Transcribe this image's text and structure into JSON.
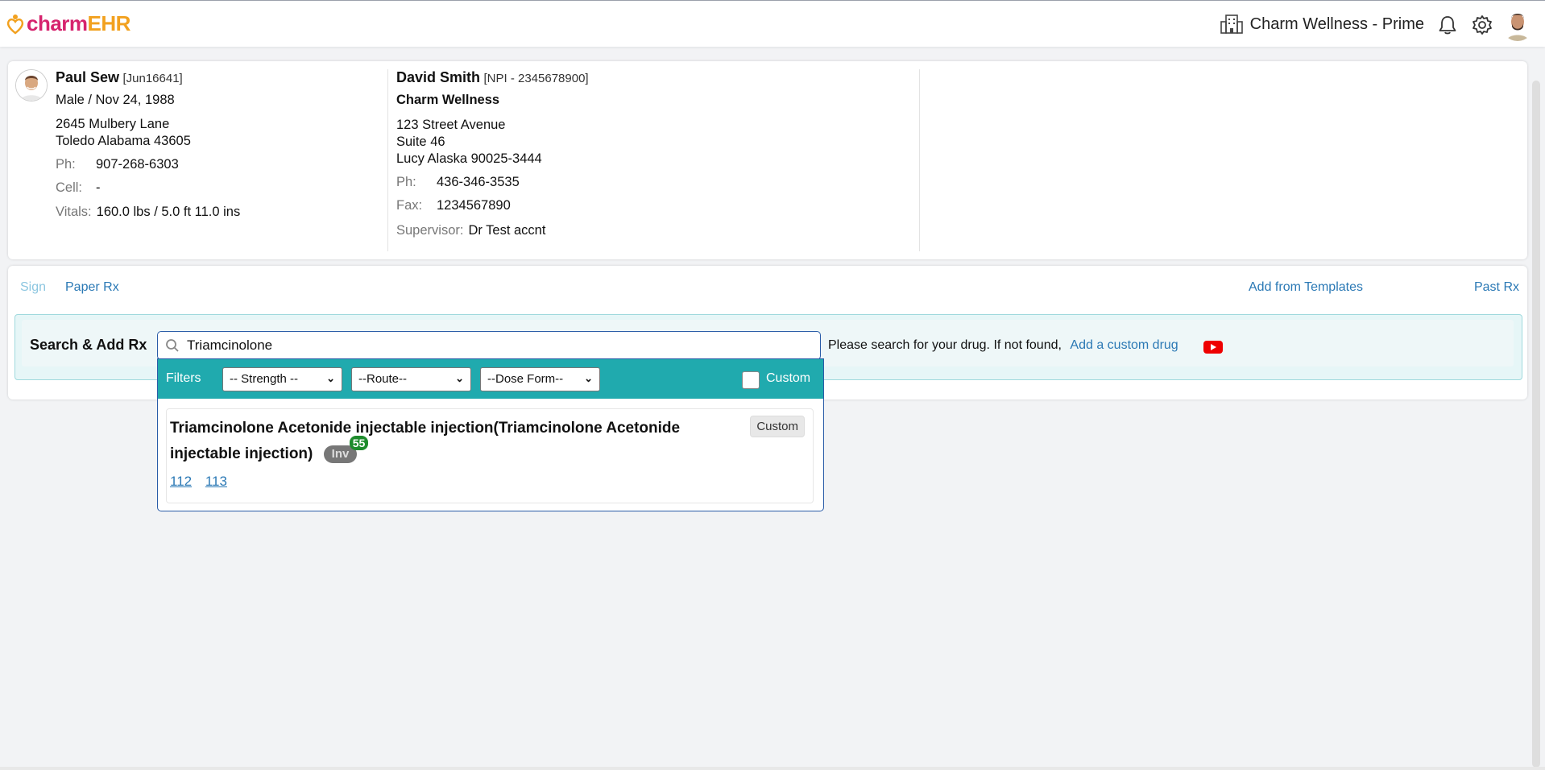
{
  "header": {
    "logo_part1": "charm",
    "logo_part2": "EHR",
    "org_name": "Charm Wellness - Prime",
    "icons": [
      "building-icon",
      "bell-icon",
      "gear-icon",
      "avatar"
    ]
  },
  "patient": {
    "name": "Paul Sew",
    "id": "[Jun16641]",
    "gender_dob": "Male / Nov 24, 1988",
    "address1": "2645 Mulbery Lane",
    "address2": "Toledo Alabama 43605",
    "phone_label": "Ph:",
    "phone": "907-268-6303",
    "cell_label": "Cell:",
    "cell": "-",
    "vitals_label": "Vitals:",
    "vitals": "160.0 lbs / 5.0 ft 11.0 ins"
  },
  "provider": {
    "name": "David Smith",
    "npi": "[NPI - 2345678900]",
    "facility": "Charm Wellness",
    "address1": "123 Street Avenue",
    "address2": "Suite 46",
    "address3": "Lucy Alaska 90025-3444",
    "phone_label": "Ph:",
    "phone": "436-346-3535",
    "fax_label": "Fax:",
    "fax": "1234567890",
    "supervisor_label": "Supervisor:",
    "supervisor": "Dr Test accnt"
  },
  "tabs": {
    "sign": "Sign",
    "paper_rx": "Paper Rx",
    "add_from_templates": "Add from Templates",
    "past_rx": "Past Rx"
  },
  "search": {
    "label": "Search & Add Rx",
    "value": "Triamcinolone",
    "hint": "Please search for your drug. If not found,",
    "custom_link": "Add a custom drug"
  },
  "filters": {
    "label": "Filters",
    "strength": "-- Strength --",
    "route": "--Route--",
    "dose_form": "--Dose Form--",
    "custom_label": "Custom",
    "custom_checked": false
  },
  "results": [
    {
      "title": "Triamcinolone Acetonide injectable injection(Triamcinolone Acetonide injectable injection)",
      "badge": "Inv",
      "badge_count": "55",
      "tag": "Custom",
      "codes": [
        "112",
        "113"
      ]
    }
  ],
  "colors": {
    "brand_pink": "#d6246e",
    "brand_orange": "#f2a11f",
    "filter_bar": "#20aaae",
    "link": "#2b79b5",
    "count_badge": "#1e8b2c"
  }
}
